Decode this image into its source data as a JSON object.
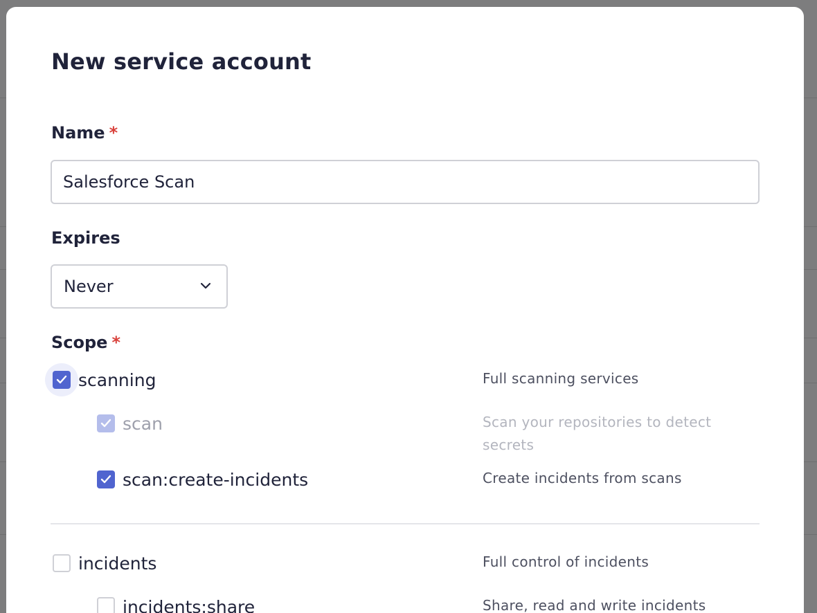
{
  "dialog": {
    "title": "New service account"
  },
  "name_field": {
    "label": "Name",
    "required_marker": "*",
    "value": "Salesforce Scan"
  },
  "expires_field": {
    "label": "Expires",
    "selected": "Never"
  },
  "scope_field": {
    "label": "Scope",
    "required_marker": "*",
    "groups": [
      {
        "name": "scanning",
        "description": "Full scanning services",
        "checked": true,
        "children": [
          {
            "name": "scan",
            "description": "Scan your repositories to detect secrets",
            "checked": true,
            "disabled": true
          },
          {
            "name": "scan:create-incidents",
            "description": "Create incidents from scans",
            "checked": true,
            "disabled": false
          }
        ]
      },
      {
        "name": "incidents",
        "description": "Full control of incidents",
        "checked": false,
        "children": [
          {
            "name": "incidents:share",
            "description": "Share, read and write incidents",
            "checked": false,
            "disabled": false
          }
        ]
      }
    ]
  },
  "colors": {
    "accent": "#5064cf",
    "accent_disabled": "#b4bdeb",
    "required": "#d9413b",
    "text": "#20233a",
    "overlay": "#7d7d7e"
  }
}
